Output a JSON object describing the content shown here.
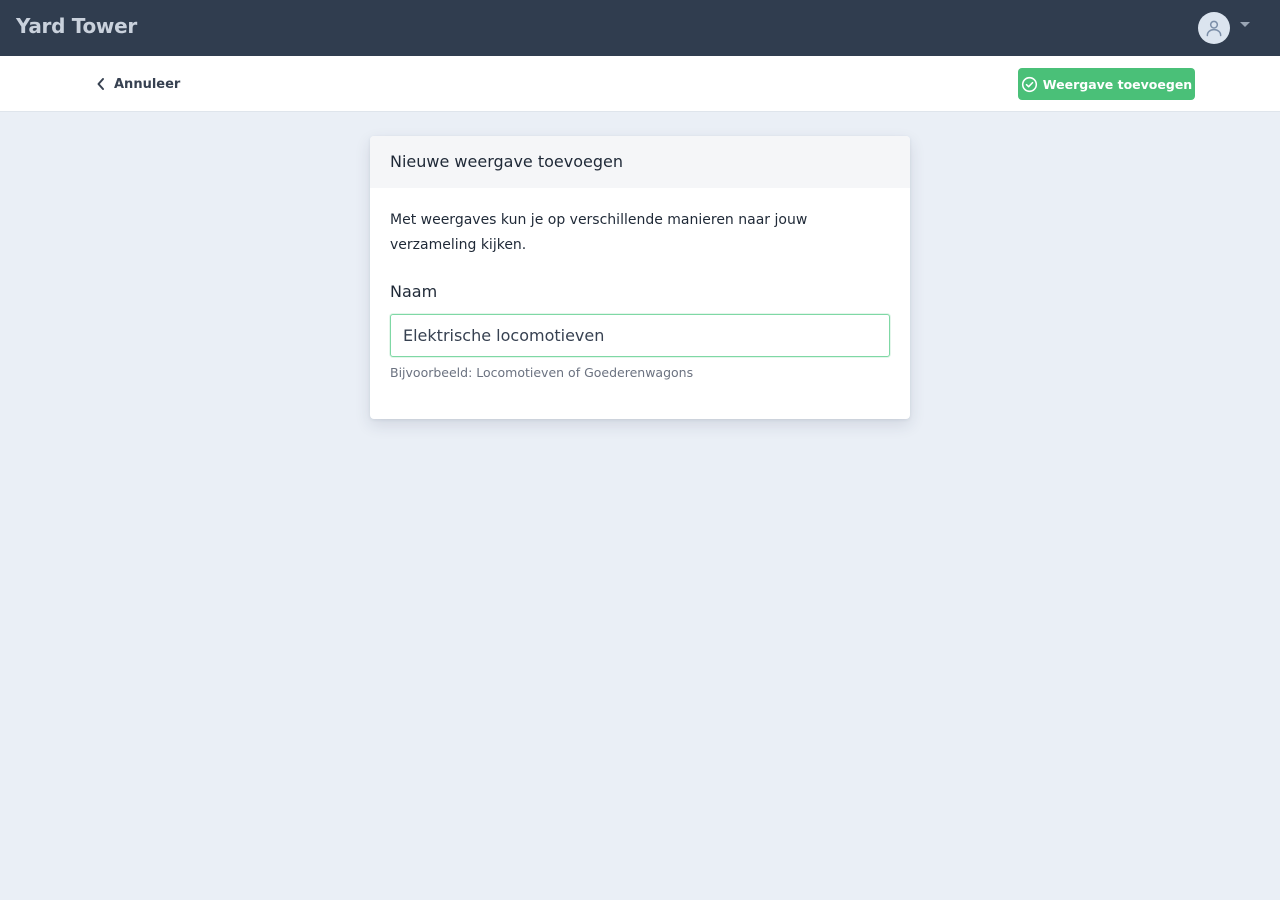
{
  "app": {
    "brand": "Yard Tower"
  },
  "user_menu": {
    "avatar_icon": "user-icon",
    "caret_icon": "caret-down-icon"
  },
  "actionbar": {
    "back_label": "Annuleer",
    "back_icon": "chevron-left-icon",
    "submit_label": "Weergave toevoegen",
    "submit_icon": "check-circle-icon"
  },
  "card": {
    "title": "Nieuwe weergave toevoegen",
    "description": "Met weergaves kun je op verschillende manieren naar jouw verzameling kijken.",
    "name_label": "Naam",
    "name_value": "Elektrische locomotieven",
    "name_hint": "Bijvoorbeeld: Locomotieven of Goederenwagons"
  },
  "colors": {
    "navbar": "#303d4f",
    "background": "#eaeff6",
    "accent": "#4ac078"
  }
}
